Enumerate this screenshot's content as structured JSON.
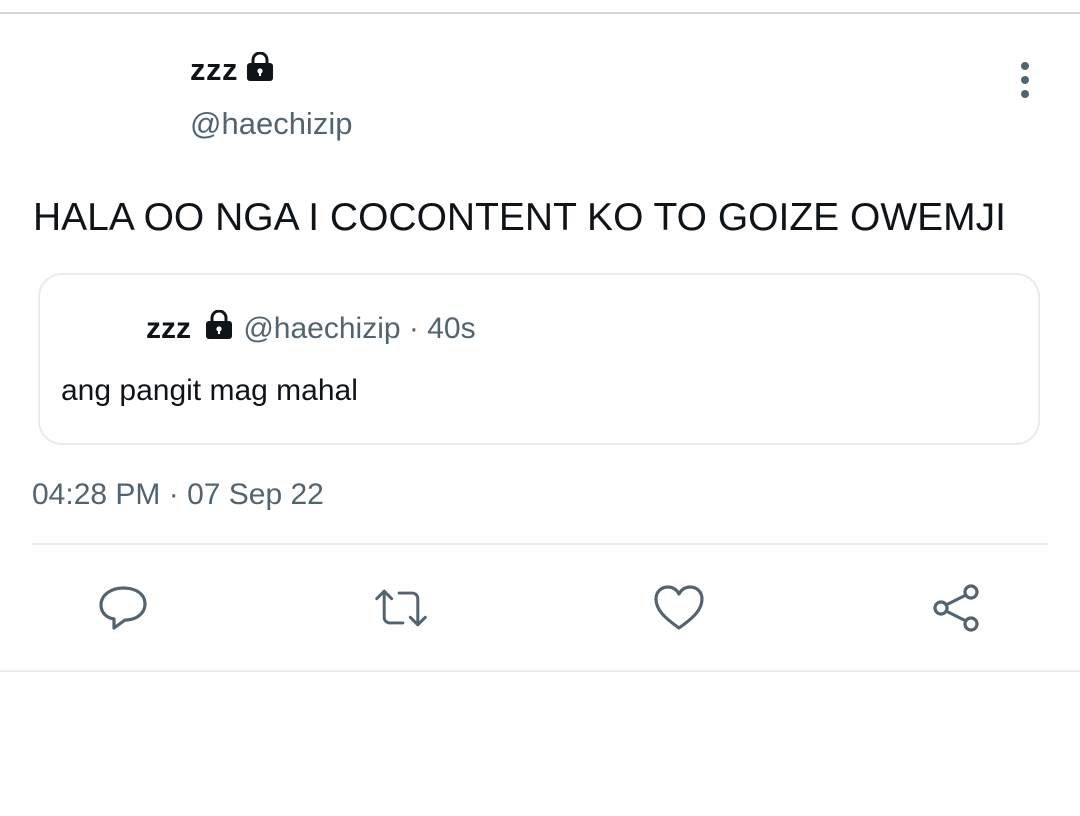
{
  "tweet": {
    "author": {
      "name": "zzz",
      "handle": "@haechizip",
      "lock_icon": "lock-icon"
    },
    "text": "HALA OO NGA I COCONTENT KO TO GOIZE OWEMJI",
    "quote": {
      "name": "zzz",
      "handle": "@haechizip",
      "separator": "·",
      "time": "40s",
      "text": "ang pangit mag mahal"
    },
    "timestamp": "04:28 PM · 07 Sep 22",
    "actions": [
      "reply-icon",
      "retweet-icon",
      "like-icon",
      "share-icon"
    ],
    "more_icon": "more-vertical-icon"
  },
  "colors": {
    "text": "#0f1419",
    "secondary": "#536471",
    "border": "#e6ecf0",
    "icon": "#536471"
  }
}
